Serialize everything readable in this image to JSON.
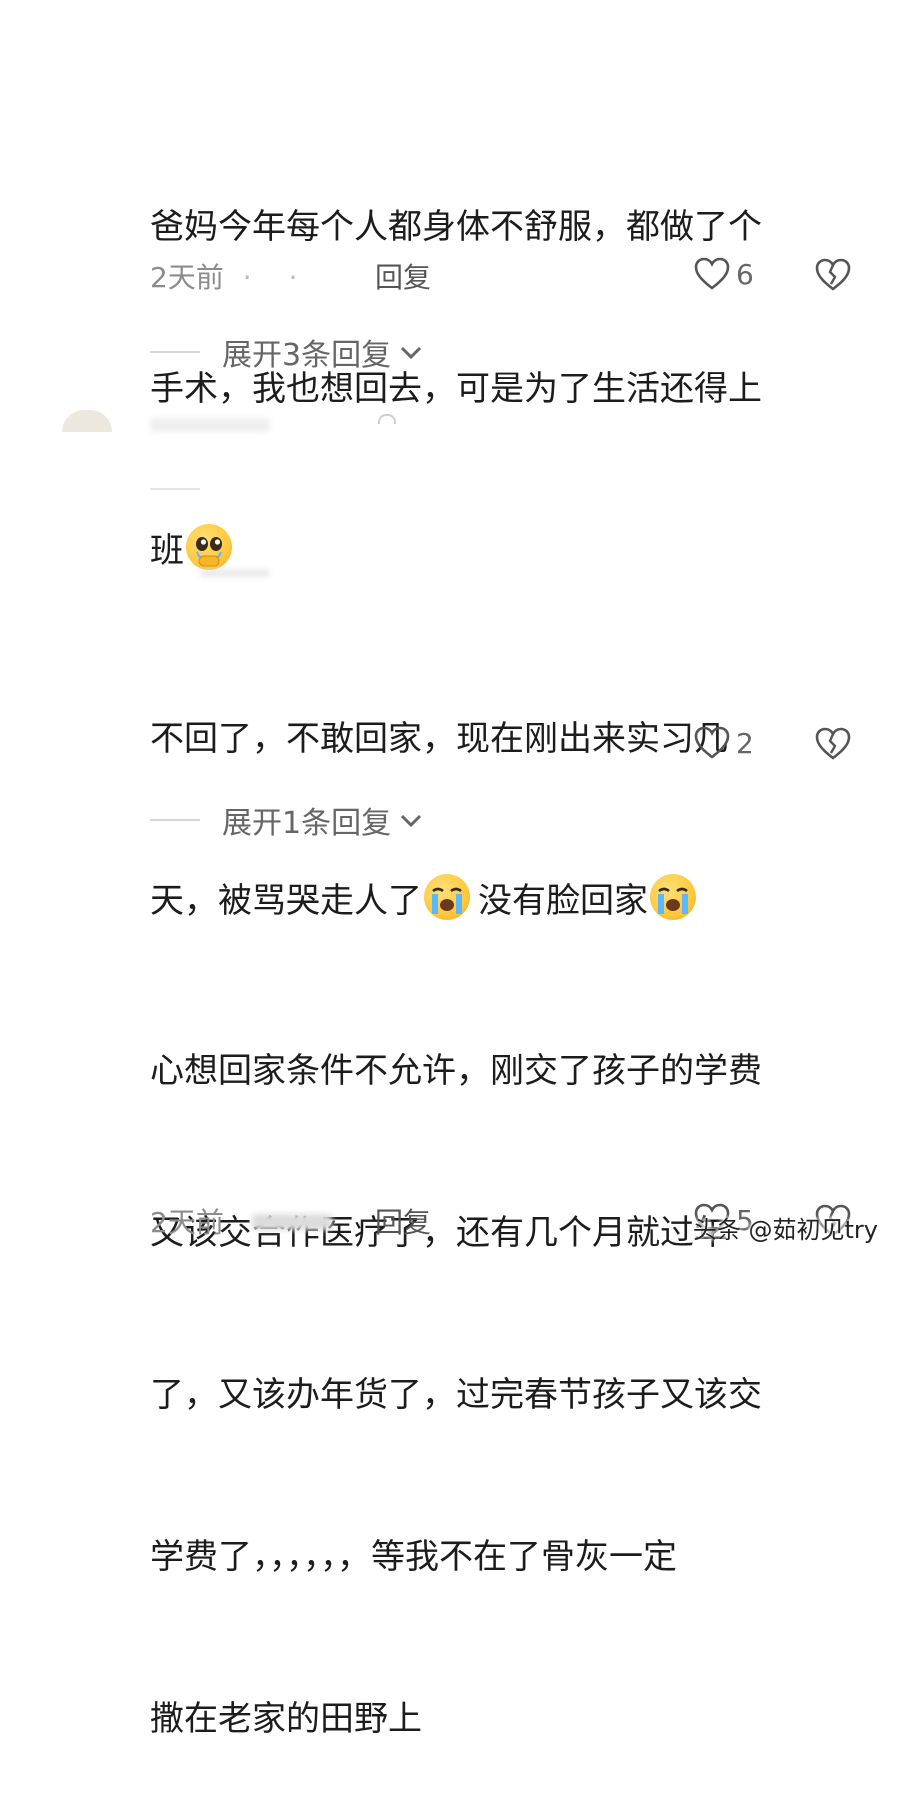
{
  "comments": [
    {
      "lines": [
        "爸妈今年每个人都身体不舒服，都做了个",
        "手术，我也想回去，可是为了生活还得上",
        "班"
      ],
      "date": "2天前",
      "separator": "·",
      "reply_label": "回复",
      "likes": "6",
      "expand_label": "展开3条回复"
    },
    {
      "line1": "不回了，不敢回家，现在刚出来实习几",
      "line2a": "天，被骂哭走人了",
      "line2b": "没有脸回家",
      "likes": "2",
      "expand_label": "展开1条回复"
    },
    {
      "lines": [
        "心想回家条件不允许，刚交了孩子的学费",
        "又该交合作医疗了，还有几个月就过年",
        "了，又该办年货了，过完春节孩子又该交",
        "学费了，，，，，，等我不在了骨灰一定",
        "撒在老家的田野上"
      ],
      "date": "2天前",
      "reply_label": "回复",
      "likes": "5"
    }
  ],
  "icons": {
    "like": "heart-outline-icon",
    "dislike": "broken-heart-icon",
    "expand": "chevron-down-icon",
    "emoji_1": "pleading-face-emoji",
    "emoji_2": "crying-face-emoji"
  },
  "watermark": "头条 @茹初见try",
  "colors": {
    "text": "#1c1c1c",
    "meta": "#8c8c8c",
    "background": "#ffffff"
  }
}
